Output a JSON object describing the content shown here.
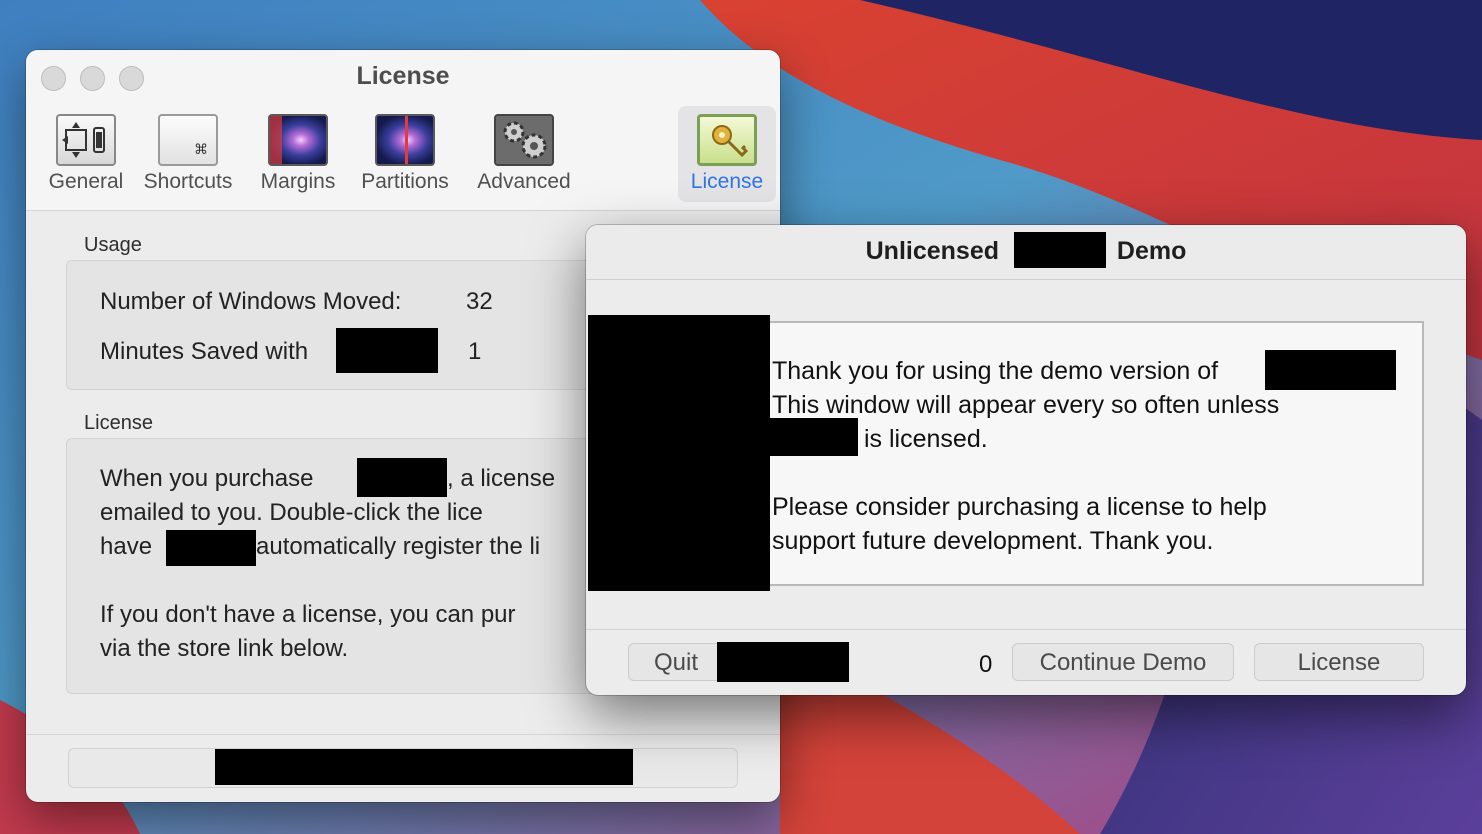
{
  "prefs_window": {
    "title": "License",
    "toolbar": [
      {
        "label": "General",
        "icon": "general-icon"
      },
      {
        "label": "Shortcuts",
        "icon": "shortcuts-icon",
        "glyph": "⌘"
      },
      {
        "label": "Margins",
        "icon": "margins-icon"
      },
      {
        "label": "Partitions",
        "icon": "partitions-icon"
      },
      {
        "label": "Advanced",
        "icon": "advanced-icon"
      },
      {
        "label": "License",
        "icon": "license-key-icon"
      }
    ],
    "usage": {
      "heading": "Usage",
      "windows_moved_label": "Number of Windows Moved:",
      "windows_moved_value": "32",
      "minutes_saved_label": "Minutes Saved with",
      "minutes_saved_value": "1"
    },
    "license": {
      "heading": "License",
      "line1_pre": "When you purchase",
      "line1_post": ", a license",
      "line2": "emailed to you.  Double-click the lice",
      "line3_pre": "have",
      "line3_post": "automatically register the li",
      "line4": "If you don't have a license, you can pur",
      "line5": "via the store link below."
    }
  },
  "dialog": {
    "title_pre": "Unlicensed",
    "title_post": "Demo",
    "message_line1": "Thank you for using the demo version of",
    "message_line2": "This window will appear every so often unless",
    "message_line3": "is licensed.",
    "message_line4": "Please consider purchasing a license to help",
    "message_line5": "support future development.  Thank you.",
    "quit_label": "Quit",
    "countdown": "0",
    "continue_label": "Continue Demo",
    "license_label": "License"
  },
  "colors": {
    "accent": "#2f74e8",
    "redaction": "#000000"
  }
}
